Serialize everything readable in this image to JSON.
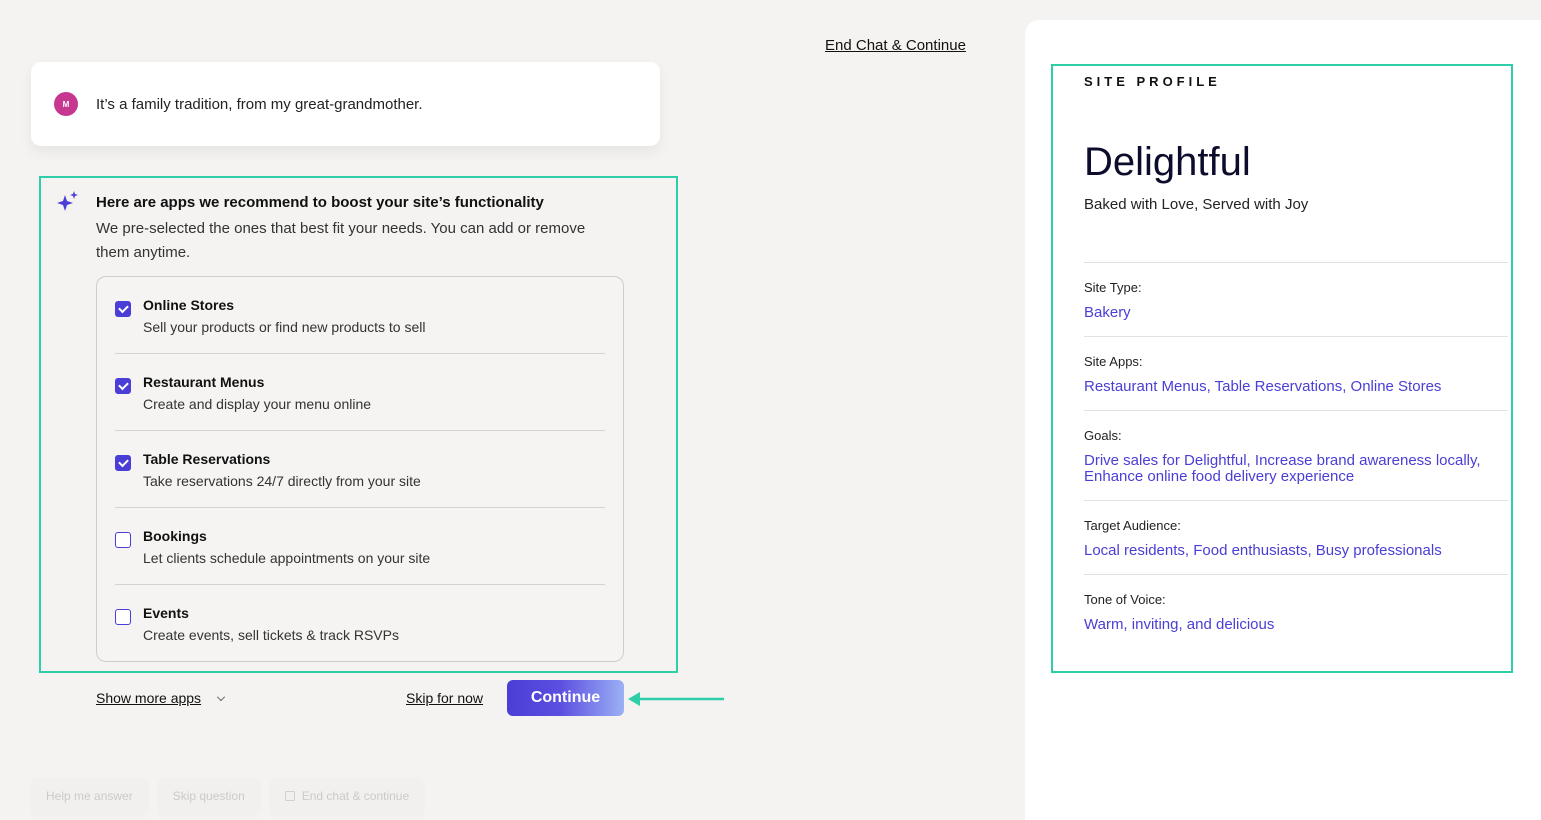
{
  "header": {
    "end_chat_label": "End Chat & Continue"
  },
  "user_message": {
    "avatar_initial": "M",
    "text": "It’s a family tradition, from my great-grandmother."
  },
  "recommendation": {
    "title": "Here are apps we recommend to boost your site’s functionality",
    "subtitle": "We pre-selected the ones that best fit your needs. You can add or remove them anytime.",
    "apps": [
      {
        "name": "Online Stores",
        "description": "Sell your products or find new products to sell",
        "checked": true
      },
      {
        "name": "Restaurant Menus",
        "description": "Create and display your menu online",
        "checked": true
      },
      {
        "name": "Table Reservations",
        "description": "Take reservations 24/7 directly from your site",
        "checked": true
      },
      {
        "name": "Bookings",
        "description": "Let clients schedule appointments on your site",
        "checked": false
      },
      {
        "name": "Events",
        "description": "Create events, sell tickets & track RSVPs",
        "checked": false
      }
    ]
  },
  "actions": {
    "show_more_label": "Show more apps",
    "skip_label": "Skip for now",
    "continue_label": "Continue"
  },
  "quick_actions": {
    "help_label": "Help me answer",
    "skip_question_label": "Skip question",
    "end_chat_label": "End chat & continue"
  },
  "site_profile": {
    "heading": "SITE PROFILE",
    "name": "Delightful",
    "tagline": "Baked with Love, Served with Joy",
    "fields": [
      {
        "label": "Site Type:",
        "value": "Bakery"
      },
      {
        "label": "Site Apps:",
        "value": "Restaurant Menus, Table Reservations, Online Stores"
      },
      {
        "label": "Goals:",
        "value": "Drive sales for Delightful, Increase brand awareness locally, Enhance online food delivery experience"
      },
      {
        "label": "Target Audience:",
        "value": "Local residents, Food enthusiasts, Busy professionals"
      },
      {
        "label": "Tone of Voice:",
        "value": "Warm, inviting, and delicious"
      }
    ]
  },
  "colors": {
    "accent": "#4a3ed6",
    "highlight": "#2ecfa8",
    "avatar": "#c6378f"
  }
}
